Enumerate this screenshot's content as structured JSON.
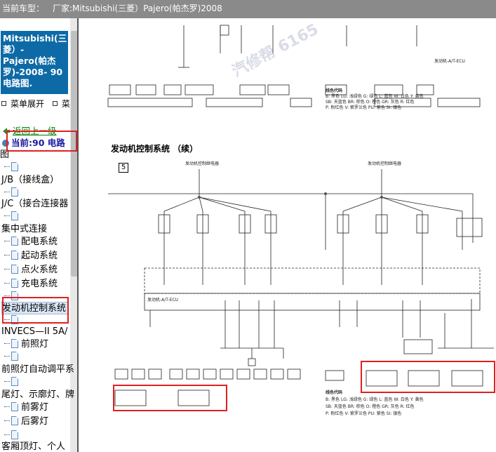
{
  "title_bar": {
    "label": "当前车型：",
    "value": "厂家:Mitsubishi(三菱）Pajero(帕杰罗)2008"
  },
  "sidebar": {
    "model_title": "Mitsubishi(三菱）-Pajero(帕杰罗)-2008- 90 电路图.",
    "menu_expand": "菜单展开",
    "menu_extra": "菜",
    "back_link": "返回上一级",
    "current": "当前:90 电路",
    "tree": [
      {
        "label": "图",
        "indent": 0,
        "doc": false
      },
      {
        "label": "",
        "indent": 1,
        "doc": true
      },
      {
        "label": "J/B（接线盒）",
        "indent": 0,
        "doc": false
      },
      {
        "label": "",
        "indent": 1,
        "doc": true
      },
      {
        "label": "J/C（接合连接器",
        "indent": 0,
        "doc": false
      },
      {
        "label": "",
        "indent": 1,
        "doc": true
      },
      {
        "label": "集中式连接",
        "indent": 0,
        "doc": false
      },
      {
        "label": "配电系统",
        "indent": 1,
        "doc": true
      },
      {
        "label": "起动系统",
        "indent": 1,
        "doc": true
      },
      {
        "label": "点火系统",
        "indent": 1,
        "doc": true
      },
      {
        "label": "充电系统",
        "indent": 1,
        "doc": true
      },
      {
        "label": "",
        "indent": 0,
        "doc": true
      },
      {
        "label": "发动机控制系统",
        "indent": 0,
        "doc": false,
        "selected": true
      },
      {
        "label": "",
        "indent": 1,
        "doc": true
      },
      {
        "label": "INVECS—II 5A/",
        "indent": 0,
        "doc": false
      },
      {
        "label": "前照灯",
        "indent": 1,
        "doc": true
      },
      {
        "label": "",
        "indent": 1,
        "doc": true
      },
      {
        "label": "前照灯自动调平系",
        "indent": 0,
        "doc": false
      },
      {
        "label": "",
        "indent": 1,
        "doc": true
      },
      {
        "label": "尾灯、示廓灯、牌",
        "indent": 0,
        "doc": false
      },
      {
        "label": "前雾灯",
        "indent": 1,
        "doc": true
      },
      {
        "label": "后雾灯",
        "indent": 1,
        "doc": true
      },
      {
        "label": "",
        "indent": 1,
        "doc": true
      },
      {
        "label": "客厢顶灯、个人",
        "indent": 0,
        "doc": false
      }
    ]
  },
  "diagram": {
    "section_title": "发动机控制系统 （续）",
    "step": "5",
    "ecu_label": "发动机-A/T-ECU",
    "relay_label": "发动机控制继电器",
    "legend_title": "线色代码",
    "legend_lines": [
      "B: 黑色 LG: 浅绿色 G: 绿色 L: 蓝色 W: 白色 Y: 黄色",
      "SB: 天蓝色 BR: 棕色 O: 橙色 GR: 灰色 R: 红色",
      "P: 粉红色 V: 紫罗兰色 PU: 紫色 SI: 银色"
    ],
    "watermark": "汽修帮 6165",
    "colors": {
      "highlight": "#e02020",
      "model_box": "#0d6aa6",
      "titlebar": "#8a8a8a"
    }
  }
}
